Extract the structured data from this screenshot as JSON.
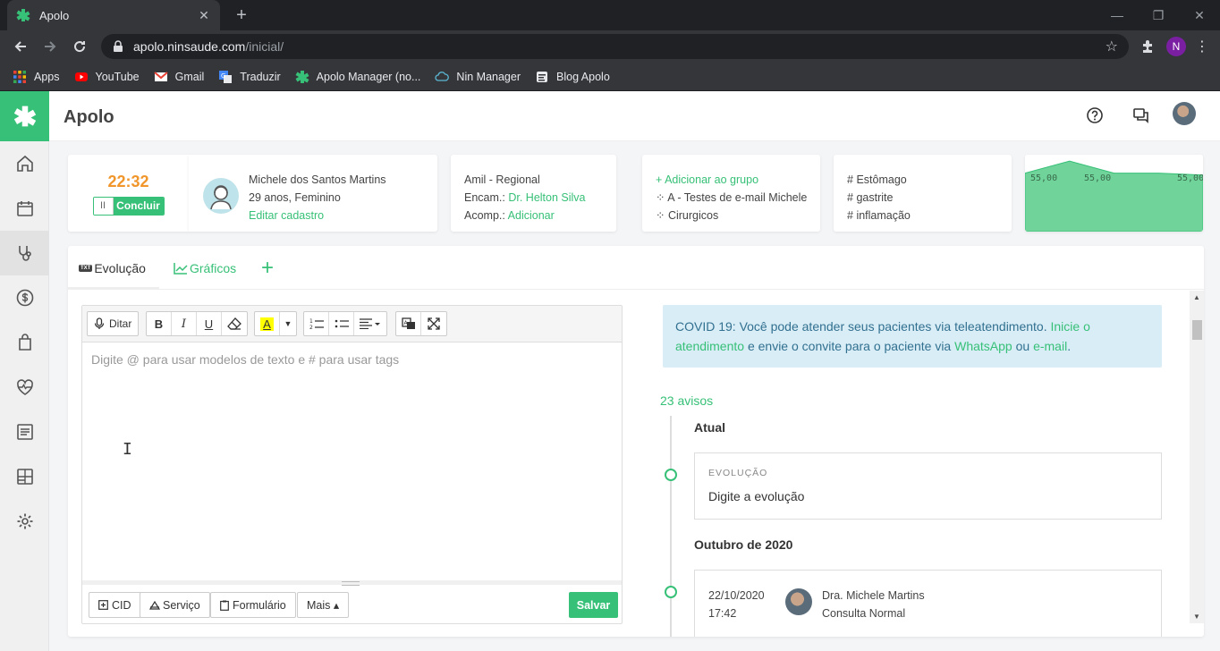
{
  "browser": {
    "tab_title": "Apolo",
    "tab_close": "✕",
    "new_tab": "+",
    "url_host": "apolo.ninsaude.com",
    "url_path": "/inicial/",
    "profile_initial": "N",
    "bookmarks": [
      {
        "label": "Apps",
        "icon": "apps-grid-icon"
      },
      {
        "label": "YouTube",
        "icon": "youtube-icon"
      },
      {
        "label": "Gmail",
        "icon": "gmail-icon"
      },
      {
        "label": "Traduzir",
        "icon": "translate-icon"
      },
      {
        "label": "Apolo Manager (no...",
        "icon": "apolo-icon"
      },
      {
        "label": "Nin Manager",
        "icon": "cloud-icon"
      },
      {
        "label": "Blog Apolo",
        "icon": "blog-icon"
      }
    ]
  },
  "app": {
    "brand": "Apolo",
    "accent": "#37c077",
    "sidebar": [
      {
        "name": "home",
        "icon": "home-icon"
      },
      {
        "name": "calendar",
        "icon": "calendar-icon"
      },
      {
        "name": "attendance",
        "icon": "stethoscope-icon",
        "active": true
      },
      {
        "name": "finance",
        "icon": "dollar-icon"
      },
      {
        "name": "inventory",
        "icon": "shopping-bag-icon"
      },
      {
        "name": "health",
        "icon": "heart-pulse-icon"
      },
      {
        "name": "reports",
        "icon": "list-icon"
      },
      {
        "name": "dashboard",
        "icon": "dashboard-icon"
      },
      {
        "name": "settings",
        "icon": "gear-icon"
      }
    ]
  },
  "timer": {
    "time": "22:32",
    "pause": "II",
    "finish": "Concluir"
  },
  "patient": {
    "name": "Michele dos Santos Martins",
    "info": "29 anos, Feminino",
    "edit": "Editar cadastro"
  },
  "insurance": {
    "plan": "Amil - Regional",
    "encam_label": "Encam.:",
    "encam_value": "Dr. Helton Silva",
    "acomp_label": "Acomp.:",
    "acomp_value": "Adicionar"
  },
  "groups": {
    "add": "Adicionar ao grupo",
    "items": [
      "A - Testes de e-mail Michele",
      "Cirurgicos"
    ]
  },
  "tags": [
    "Estômago",
    "gastrite",
    "inflamação"
  ],
  "sparkline": {
    "labels": [
      "55,00",
      "55,00",
      "55,00"
    ],
    "values": [
      55,
      58,
      55,
      55,
      54.5
    ]
  },
  "tabs": {
    "evolucao_badge": "TXT",
    "evolucao": "Evolução",
    "graficos": "Gráficos",
    "add": "+"
  },
  "editor": {
    "dictate": "Ditar",
    "placeholder": "Digite @ para usar modelos de texto e # para usar tags",
    "cursor": "I",
    "buttons": {
      "cid": "CID",
      "servico": "Serviço",
      "formulario": "Formulário",
      "mais": "Mais ▴",
      "save": "Salvar"
    }
  },
  "covid": {
    "text1": "COVID 19: Você pode atender seus pacientes via teleatendimento. ",
    "link1": "Inicie o atendimento",
    "text2": " e envie o convite para o paciente via ",
    "link2": "WhatsApp",
    "text3": " ou ",
    "link3": "e-mail",
    "text4": "."
  },
  "timeline": {
    "avisos": "23 avisos",
    "current": "Atual",
    "evo_label": "EVOLUÇÃO",
    "evo_value": "Digite a evolução",
    "month": "Outubro de 2020",
    "entry": {
      "date": "22/10/2020",
      "time": "17:42",
      "doctor": "Dra. Michele Martins",
      "type": "Consulta Normal"
    }
  }
}
